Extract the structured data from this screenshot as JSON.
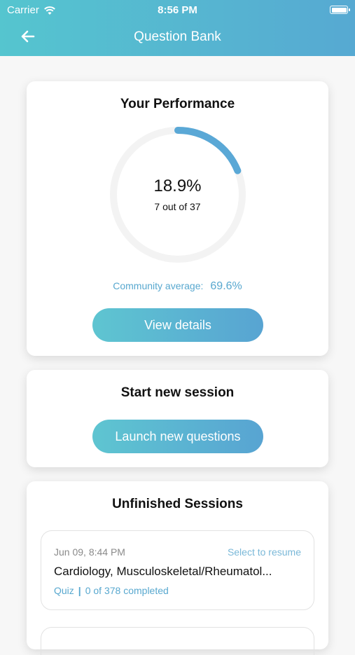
{
  "status_bar": {
    "carrier": "Carrier",
    "time": "8:56 PM"
  },
  "header": {
    "title": "Question Bank",
    "back_icon": "back-arrow-icon"
  },
  "performance": {
    "heading": "Your Performance",
    "percent_label": "18.9%",
    "percent_value": 0.189,
    "count_label": "7 out of 37",
    "community_label": "Community average:",
    "community_value": "69.6%",
    "button_label": "View details",
    "ring_color": "#5aa8d6",
    "track_color": "#f3f3f3"
  },
  "start_session": {
    "heading": "Start new session",
    "button_label": "Launch new questions"
  },
  "unfinished": {
    "heading": "Unfinished Sessions",
    "sessions": [
      {
        "date": "Jun 09, 8:44 PM",
        "resume_label": "Select to resume",
        "topic": "Cardiology, Musculoskeletal/Rheumatol...",
        "type": "Quiz",
        "progress": "0 of 378 completed"
      }
    ]
  },
  "colors": {
    "accent": "#58a8cf",
    "header_start": "#55c5cf",
    "header_end": "#56a9d2"
  }
}
